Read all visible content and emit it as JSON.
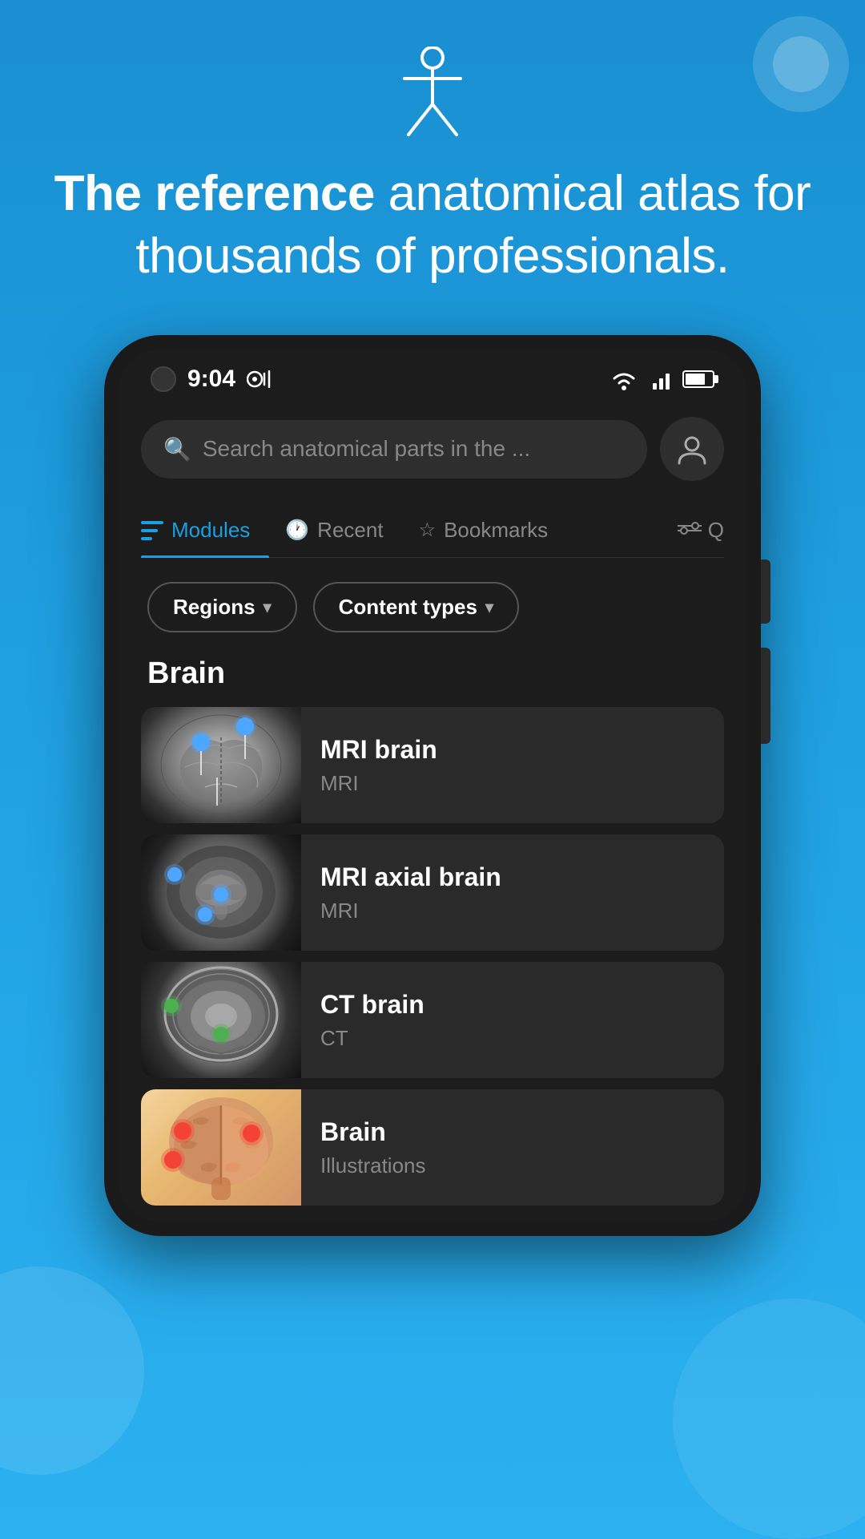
{
  "app": {
    "background_color": "#1a8fd1"
  },
  "header": {
    "hero_title_bold": "The reference",
    "hero_title_regular": " anatomical atlas for thousands of professionals."
  },
  "status_bar": {
    "time": "9:04",
    "icons": [
      "wifi",
      "signal",
      "battery"
    ]
  },
  "search": {
    "placeholder": "Search anatomical parts in the ..."
  },
  "tabs": [
    {
      "id": "modules",
      "label": "Modules",
      "active": true
    },
    {
      "id": "recent",
      "label": "Recent",
      "active": false
    },
    {
      "id": "bookmarks",
      "label": "Bookmarks",
      "active": false
    },
    {
      "id": "more",
      "label": "Q",
      "active": false
    }
  ],
  "filters": [
    {
      "id": "regions",
      "label": "Regions"
    },
    {
      "id": "content_types",
      "label": "Content types"
    }
  ],
  "sections": [
    {
      "title": "Brain",
      "items": [
        {
          "id": "mri-brain",
          "title": "MRI brain",
          "subtitle": "MRI",
          "image_type": "mri_sagittal"
        },
        {
          "id": "mri-axial-brain",
          "title": "MRI axial brain",
          "subtitle": "MRI",
          "image_type": "mri_axial"
        },
        {
          "id": "ct-brain",
          "title": "CT brain",
          "subtitle": "CT",
          "image_type": "ct"
        },
        {
          "id": "brain-illustration",
          "title": "Brain",
          "subtitle": "Illustrations",
          "image_type": "illustration"
        }
      ]
    }
  ]
}
